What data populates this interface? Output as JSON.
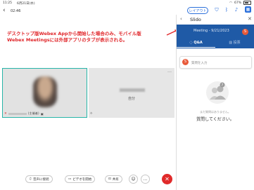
{
  "status_bar": {
    "time": "11:25",
    "date": "6月21日(水)",
    "battery": "67%"
  },
  "meeting": {
    "timer": "02:46",
    "layout_button": "レイアウト"
  },
  "annotation": {
    "line1": "デスクトップ版Webex Appから開始した場合のみ、モバイル版",
    "line2": "Webex Meetingsには外部アプリのタブが表示される。",
    "color": "#e0262a"
  },
  "tiles": {
    "self_name_suffix": "(主催者)",
    "other_label": "自分"
  },
  "toolbar": {
    "audio_label": "音声に接続",
    "video_label": "ビデオを開始",
    "share_label": "共有"
  },
  "slido": {
    "title": "Slido",
    "meeting_label": "Meeting - 9/21/2023",
    "tab_qa": "Q&A",
    "tab_polls": "投票",
    "input_placeholder": "質問を入力",
    "empty_line1": "まだ質問はありません。",
    "empty_line2": "質問してください。",
    "header_color": "#1f5aa6",
    "accent_color": "#e85a3a"
  },
  "icons": {
    "back": "chevron-left-icon",
    "apps": "apps-icon",
    "end_call": "end-call-icon"
  }
}
